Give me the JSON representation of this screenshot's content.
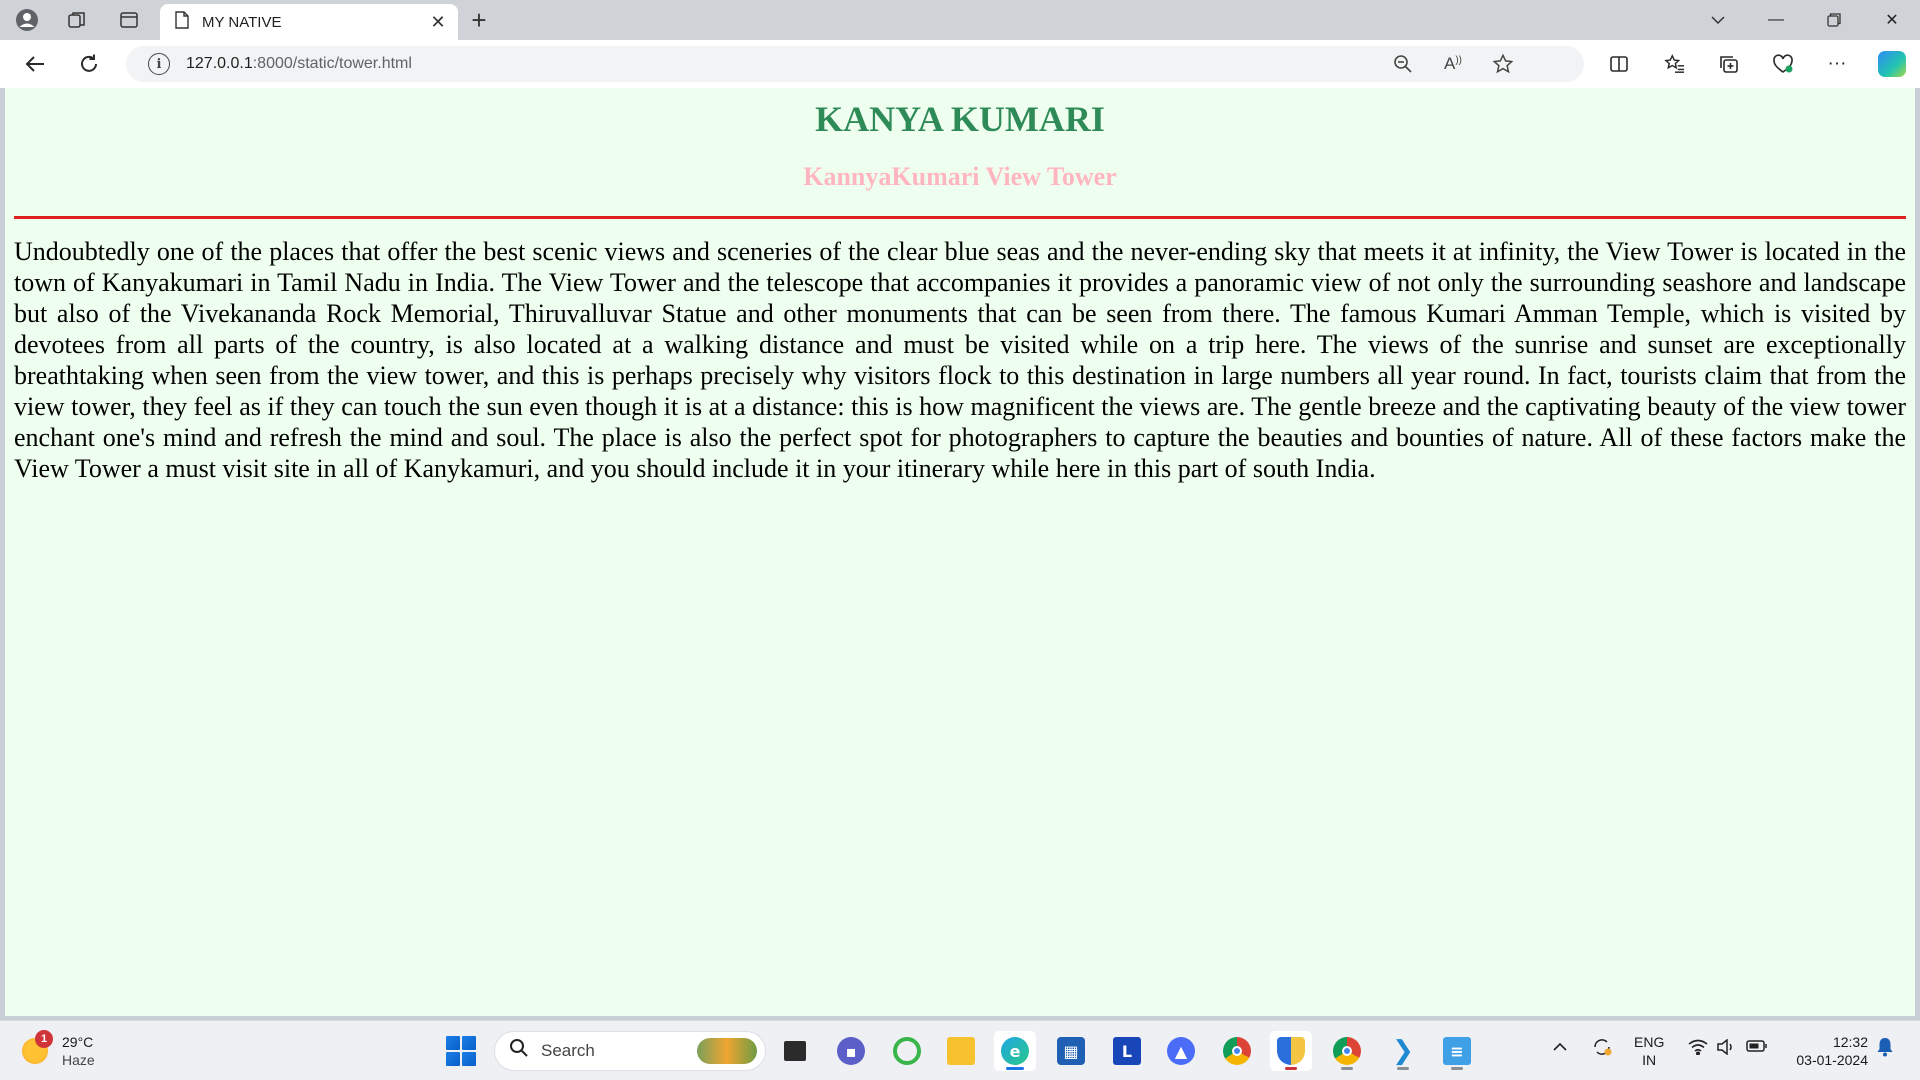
{
  "browser": {
    "tab_title": "MY NATIVE",
    "url_host": "127.0.0.1",
    "url_rest": ":8000/static/tower.html"
  },
  "page": {
    "heading": "KANYA KUMARI",
    "subheading": "KannyaKumari View Tower",
    "paragraph": "Undoubtedly one of the places that offer the best scenic views and sceneries of the clear blue seas and the never-ending sky that meets it at infinity, the View Tower is located in the town of Kanyakumari in Tamil Nadu in India. The View Tower and the telescope that accompanies it provides a panoramic view of not only the surrounding seashore and landscape but also of the Vivekananda Rock Memorial, Thiruvalluvar Statue and other monuments that can be seen from there. The famous Kumari Amman Temple, which is visited by devotees from all parts of the country, is also located at a walking distance and must be visited while on a trip here. The views of the sunrise and sunset are exceptionally breathtaking when seen from the view tower, and this is perhaps precisely why visitors flock to this destination in large numbers all year round. In fact, tourists claim that from the view tower, they feel as if they can touch the sun even though it is at a distance: this is how magnificent the views are. The gentle breeze and the captivating beauty of the view tower enchant one's mind and refresh the mind and soul. The place is also the perfect spot for photographers to capture the beauties and bounties of nature. All of these factors make the View Tower a must visit site in all of Kanykamuri, and you should include it in your itinerary while here in this part of south India.",
    "colors": {
      "heading": "#2e8b57",
      "subheading": "#ffb6c1",
      "rule": "#e0201f",
      "background": "#efffef"
    }
  },
  "taskbar": {
    "weather_badge": "1",
    "temperature": "29°C",
    "condition": "Haze",
    "search_label": "Search",
    "lang_primary": "ENG",
    "lang_region": "IN",
    "time": "12:32",
    "date": "03-01-2024",
    "apps": [
      "task-view",
      "teams-chat",
      "copilot-ring",
      "file-explorer",
      "edge",
      "microsoft-store",
      "l-app",
      "vpn-app",
      "chrome",
      "security-shield",
      "chrome-profile",
      "vscode",
      "notepad"
    ]
  }
}
